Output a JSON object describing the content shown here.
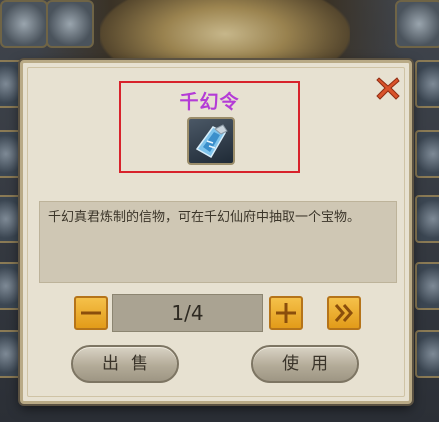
{
  "dialog": {
    "item_name": "千幻令",
    "item_icon": "jade-token-icon",
    "description": "千幻真君炼制的信物，可在千幻仙府中抽取一个宝物。",
    "quantity": {
      "display": "1/4",
      "current": 1,
      "max": 4
    },
    "buttons": {
      "sell": "出售",
      "use": "使用"
    },
    "icons": {
      "close": "close-icon",
      "minus": "minus-icon",
      "plus": "plus-icon",
      "max": "double-chevron-right-icon"
    }
  },
  "colors": {
    "title": "#b43cd6",
    "highlight_box": "#d8222b",
    "close": "#d9532b",
    "stepper_button": "#f0b233"
  }
}
